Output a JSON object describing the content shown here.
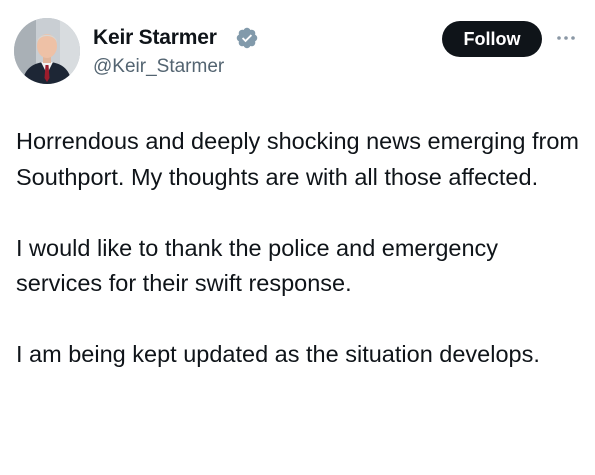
{
  "author": {
    "display_name": "Keir Starmer",
    "handle": "@Keir_Starmer",
    "verified": true,
    "verified_color": "#829aab"
  },
  "actions": {
    "follow_label": "Follow",
    "more_icon": "more-horizontal-icon"
  },
  "tweet": {
    "paragraphs": [
      "Horrendous and deeply shocking news emerging from Southport. My thoughts are with all those affected.",
      "I would like to thank the police and emergency services for their swift response.",
      "I am being kept updated as the situation develops."
    ]
  },
  "colors": {
    "text": "#0f1419",
    "secondary_text": "#536471",
    "follow_button_bg": "#0f1419"
  }
}
